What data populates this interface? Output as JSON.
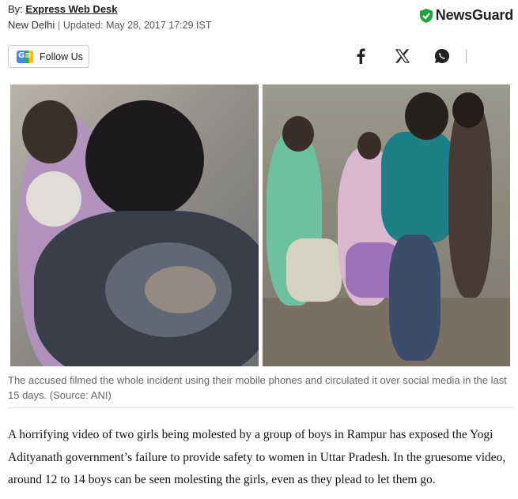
{
  "byline": {
    "prefix": "By: ",
    "author": "Express Web Desk"
  },
  "dateline": {
    "place": "New Delhi",
    "separator": " | ",
    "updated": "Updated: May 28, 2017 17:29 IST"
  },
  "newsguard": {
    "label": "NewsGuard",
    "icon": "shield-check-icon",
    "color": "#1da33f"
  },
  "follow": {
    "label": "Follow Us",
    "icon": "google-news-icon"
  },
  "share": {
    "icons": [
      "facebook-icon",
      "x-icon",
      "whatsapp-icon"
    ]
  },
  "image": {
    "caption": "The accused filmed the whole incident using their mobile phones and circulated it over social media in the last 15 days. (Source: ANI)"
  },
  "article": {
    "paragraph": "A horrifying video of two girls being molested by a group of boys in Rampur has exposed the Yogi Adityanath government’s failure to provide safety to women in Uttar Pradesh. In the gruesome video, around 12 to 14 boys can be seen molesting the girls, even as they plead to let them go."
  }
}
